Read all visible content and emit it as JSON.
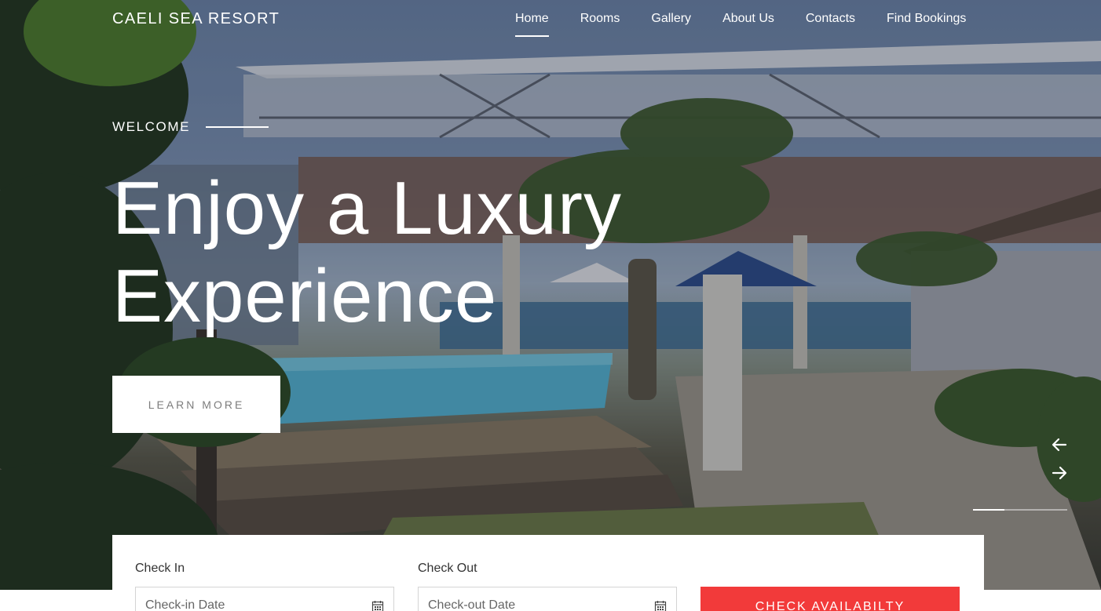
{
  "brand": {
    "name": "CAELI SEA RESORT"
  },
  "nav": {
    "items": [
      {
        "label": "Home",
        "active": true
      },
      {
        "label": "Rooms",
        "active": false
      },
      {
        "label": "Gallery",
        "active": false
      },
      {
        "label": "About Us",
        "active": false
      },
      {
        "label": "Contacts",
        "active": false
      },
      {
        "label": "Find Bookings",
        "active": false
      }
    ]
  },
  "hero": {
    "eyebrow": "WELCOME",
    "headline_line1": "Enjoy a Luxury",
    "headline_line2": "Experience",
    "cta_label": "LEARN MORE",
    "slider": {
      "prev_icon": "arrow-left-icon",
      "next_icon": "arrow-right-icon",
      "progress": 0.33
    }
  },
  "booking": {
    "check_in": {
      "label": "Check In",
      "placeholder": "Check-in Date",
      "value": "",
      "icon": "calendar-icon"
    },
    "check_out": {
      "label": "Check Out",
      "placeholder": "Check-out Date",
      "value": "",
      "icon": "calendar-icon"
    },
    "submit_label": "CHECK AVAILABILTY"
  },
  "colors": {
    "accent": "#f23a3a",
    "text_light": "#ffffff",
    "button_text": "#7d7d7d"
  }
}
